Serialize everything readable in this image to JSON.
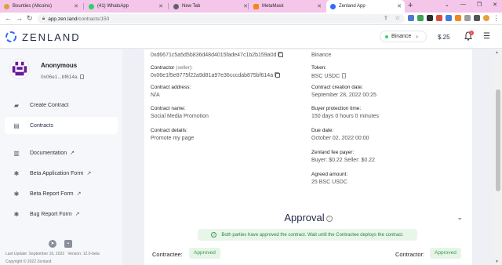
{
  "browser": {
    "tabs": [
      {
        "title": "Bounties (Altcoins)",
        "favicon_color": "#d9a43b",
        "favicon": "bounties-favicon-icon"
      },
      {
        "title": "(41) WhatsApp",
        "favicon_color": "#25d366",
        "favicon": "whatsapp-icon"
      },
      {
        "title": "New Tab",
        "favicon_color": "#5f6368",
        "favicon": "chrome-icon"
      },
      {
        "title": "MetaMask",
        "favicon_color": "#f6851b",
        "favicon": "metamask-fox-icon"
      },
      {
        "title": "Zenland App",
        "favicon_color": "#2f6df6",
        "favicon": "zenland-icon"
      }
    ],
    "url_host": "app.zen.land",
    "url_path": "/contracts/150"
  },
  "header": {
    "logo_text": "ZENLAND",
    "network": "Binance",
    "balance": "$.25",
    "notification_count": "1"
  },
  "sidebar": {
    "user_name": "Anonymous",
    "user_address": "0x06e1...bf614a",
    "items": [
      {
        "label": "Create Contract",
        "icon": "create-contract-icon"
      },
      {
        "label": "Contracts",
        "icon": "contracts-icon"
      },
      {
        "label": "Documentation",
        "icon": "documentation-icon"
      },
      {
        "label": "Beta Application Form",
        "icon": "bug-icon"
      },
      {
        "label": "Beta Report Form",
        "icon": "bug-icon"
      },
      {
        "label": "Bug Report Form",
        "icon": "bug-icon"
      }
    ],
    "footer_update": "Last Update: September 16, 2022",
    "footer_version": "Version: 12.0-beta",
    "footer_copyright": "Copyright © 2022 Zenland"
  },
  "contract": {
    "contractee_address": "0xd6671c5a5d5b836d48d4015fade47c1b2b159a0d",
    "chain": "Binance",
    "contractor_label": "Contractor",
    "contractor_role": "(seller):",
    "contractor_address": "0x06e1f5e8775f22a9d81a97e36cccdab875bf614a",
    "token_label": "Token:",
    "token_value": "BSC USDC",
    "contract_address_label": "Contract address:",
    "contract_address_value": "N/A",
    "creation_date_label": "Contract creation date:",
    "creation_date_value": "September 28, 2022 00:25",
    "name_label": "Contract name:",
    "name_value": "Social Media Promotion",
    "buyer_protection_label": "Buyer protection time:",
    "buyer_protection_value": "150 days 0 hours 0 minutes",
    "details_label": "Contract details:",
    "details_value": "Promote my page",
    "due_date_label": "Due date:",
    "due_date_value": "October 02, 2022 00:00",
    "fee_payer_label": "Zenland fee payer:",
    "fee_payer_value": "Buyer: $0.22 Seller: $0.22",
    "agreed_amount_label": "Agreed amount:",
    "agreed_amount_value": "25 BSC USDC"
  },
  "approval": {
    "title": "Approval",
    "banner": "Both parties have approved the contract. Wait until the Contractee deploys the contract.",
    "contractee_label": "Contractee:",
    "contractee_status": "Approved",
    "contractor_label": "Contractor:",
    "contractor_status": "Approved"
  },
  "colors": {
    "brand": "#1f2a44",
    "accent_green": "#3a9b4c",
    "tab_strip": "#f4c6ea",
    "avatar_purple": "#6a1b9a"
  }
}
